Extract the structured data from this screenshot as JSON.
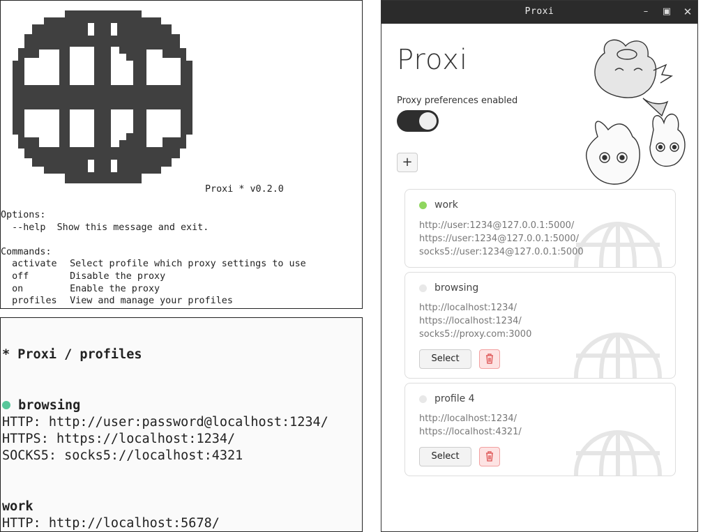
{
  "terminal_help": {
    "version": "Proxi * v0.2.0",
    "options_heading": "Options:",
    "options": [
      {
        "flag": "--help",
        "desc": "Show this message and exit."
      }
    ],
    "commands_heading": "Commands:",
    "commands": [
      {
        "cmd": "activate",
        "desc": "Select profile which proxy settings to use"
      },
      {
        "cmd": "off",
        "desc": "Disable the proxy"
      },
      {
        "cmd": "on",
        "desc": "Enable the proxy"
      },
      {
        "cmd": "profiles",
        "desc": "View and manage your profiles"
      }
    ]
  },
  "terminal_profiles": {
    "title": "* Proxi / profiles",
    "profiles": [
      {
        "name": "browsing",
        "lines": [
          "HTTP: http://user:password@localhost:1234/",
          "HTTPS: https://localhost:1234/",
          "SOCKS5: socks5://localhost:4321"
        ]
      },
      {
        "name": "work",
        "lines": [
          "HTTP: http://localhost:5678/"
        ]
      }
    ]
  },
  "app": {
    "window_title": "Proxi",
    "logo_text": "Proxi",
    "toggle_label": "Proxy preferences enabled",
    "toggle_on": true,
    "add_label": "+",
    "select_label": "Select",
    "cards": [
      {
        "name": "work",
        "active": true,
        "urls": [
          "http://user:1234@127.0.0.1:5000/",
          "https://user:1234@127.0.0.1:5000/",
          "socks5://user:1234@127.0.0.1:5000"
        ]
      },
      {
        "name": "browsing",
        "active": false,
        "urls": [
          "http://localhost:1234/",
          "https://localhost:1234/",
          "socks5://proxy.com:3000"
        ]
      },
      {
        "name": "profile 4",
        "active": false,
        "urls": [
          "http://localhost:1234/",
          "https://localhost:4321/"
        ]
      }
    ],
    "colors": {
      "active_dot": "#8fd65e",
      "delete_red": "#e06060",
      "terminal_dot": "#57c79a"
    }
  }
}
